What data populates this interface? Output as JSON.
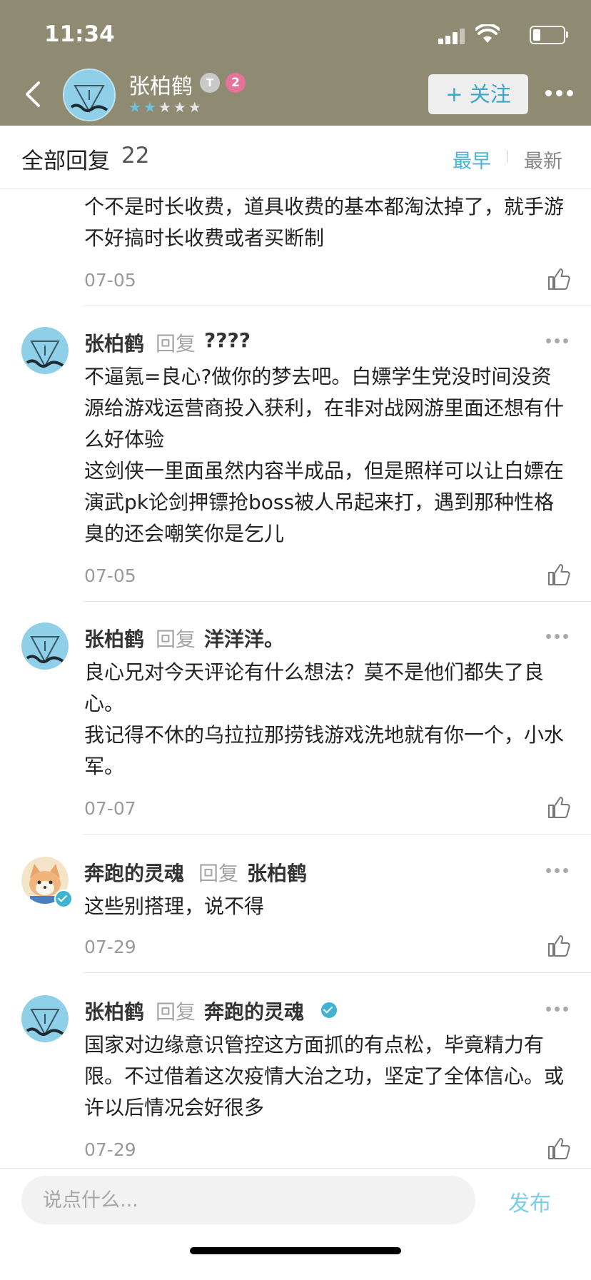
{
  "status_bar": {
    "time": "11:34"
  },
  "header": {
    "username": "张柏鹤",
    "level_badge": "T",
    "count_badge": "2",
    "stars_filled": 2,
    "stars_total": 5,
    "follow_label": "+ 关注"
  },
  "sort_bar": {
    "title": "全部回复",
    "count": "22",
    "options": [
      "最早",
      "最新"
    ],
    "active": "最早"
  },
  "comments": [
    {
      "text": "个不是时长收费，道具收费的基本都淘汰掉了，就手游不好搞时长收费或者买断制",
      "date": "07-05"
    },
    {
      "author": "张柏鹤",
      "reply_word": "回复",
      "target": "????",
      "text": "不逼氪=良心?做你的梦去吧。白嫖学生党没时间没资源给游戏运营商投入获利，在非对战网游里面还想有什么好体验\n这剑侠一里面虽然内容半成品，但是照样可以让白嫖在演武pk论剑押镖抢boss被人吊起来打，遇到那种性格臭的还会嘲笑你是乞儿",
      "date": "07-05"
    },
    {
      "author": "张柏鹤",
      "reply_word": "回复",
      "target": "洋洋洋。",
      "text": "良心兄对今天评论有什么想法？莫不是他们都失了良心。\n我记得不休的乌拉拉那捞钱游戏洗地就有你一个，小水军。",
      "date": "07-07"
    },
    {
      "author": "奔跑的灵魂",
      "reply_word": "回复",
      "target": "张柏鹤",
      "text": "这些别搭理，说不得",
      "date": "07-29"
    },
    {
      "author": "张柏鹤",
      "reply_word": "回复",
      "target": "奔跑的灵魂",
      "text": "国家对边缘意识管控这方面抓的有点松，毕竟精力有限。不过借着这次疫情大治之功，坚定了全体信心。或许以后情况会好很多",
      "date": "07-29"
    }
  ],
  "composer": {
    "placeholder": "说点什么...",
    "publish_label": "发布"
  },
  "colors": {
    "header_bg": "#8e8b72",
    "accent": "#4db3d4",
    "publish": "#7ccde6",
    "verified": "#3fb3cf"
  }
}
